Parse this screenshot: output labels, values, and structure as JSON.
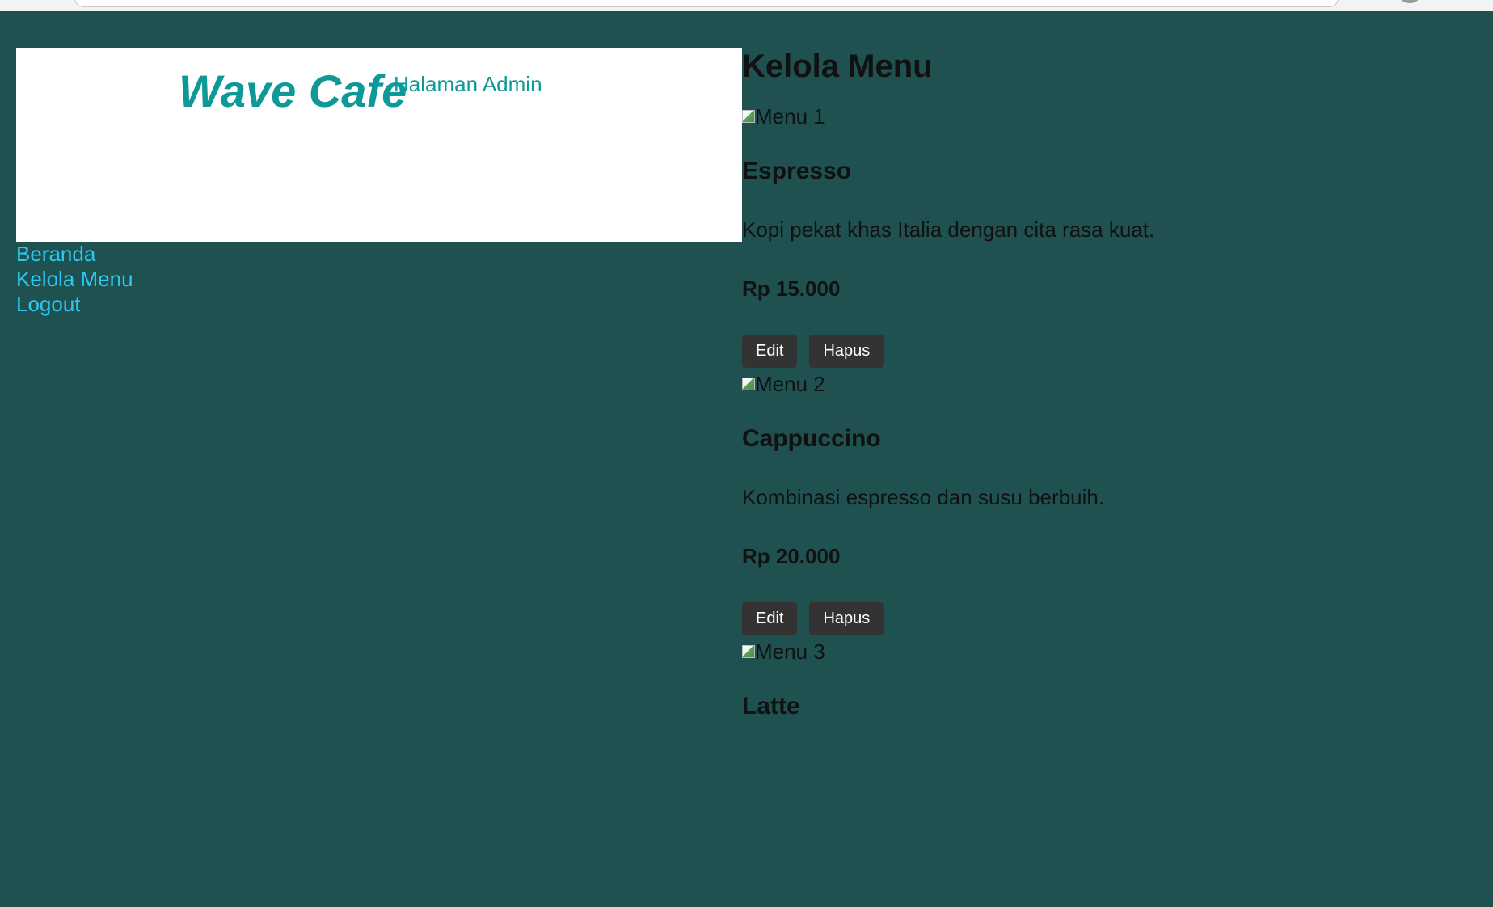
{
  "header": {
    "brand": "Wave Cafe",
    "subtitle": "Halaman Admin"
  },
  "nav": [
    {
      "label": "Beranda"
    },
    {
      "label": "Kelola Menu"
    },
    {
      "label": "Logout"
    }
  ],
  "main": {
    "title": "Kelola Menu",
    "items": [
      {
        "image_alt": "Menu 1",
        "name": "Espresso",
        "description": "Kopi pekat khas Italia dengan cita rasa kuat.",
        "price": "Rp 15.000",
        "edit_label": "Edit",
        "delete_label": "Hapus"
      },
      {
        "image_alt": "Menu 2",
        "name": "Cappuccino",
        "description": "Kombinasi espresso dan susu berbuih.",
        "price": "Rp 20.000",
        "edit_label": "Edit",
        "delete_label": "Hapus"
      },
      {
        "image_alt": "Menu 3",
        "name": "Latte"
      }
    ]
  },
  "colors": {
    "background": "#1f5151",
    "brand": "#0e9999",
    "nav_link": "#2bc9f2",
    "button": "#333333"
  }
}
